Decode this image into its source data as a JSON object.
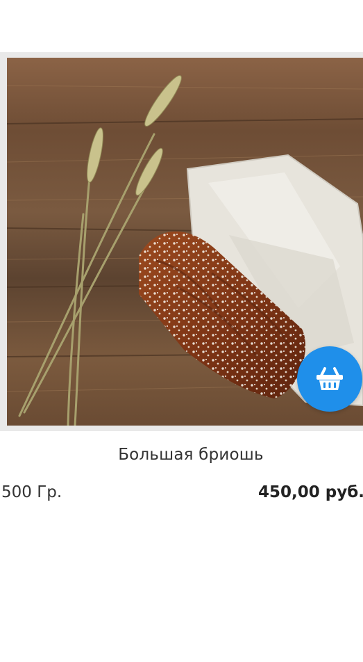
{
  "product": {
    "title": "Большая бриошь",
    "weight": "500 Гр.",
    "price": "450,00 руб.",
    "image_icon": "brioche-photo",
    "cart_icon": "shopping-basket-icon"
  },
  "colors": {
    "cart_button": "#1f8fea",
    "image_frame": "#e9e9e9",
    "text": "#333333"
  }
}
